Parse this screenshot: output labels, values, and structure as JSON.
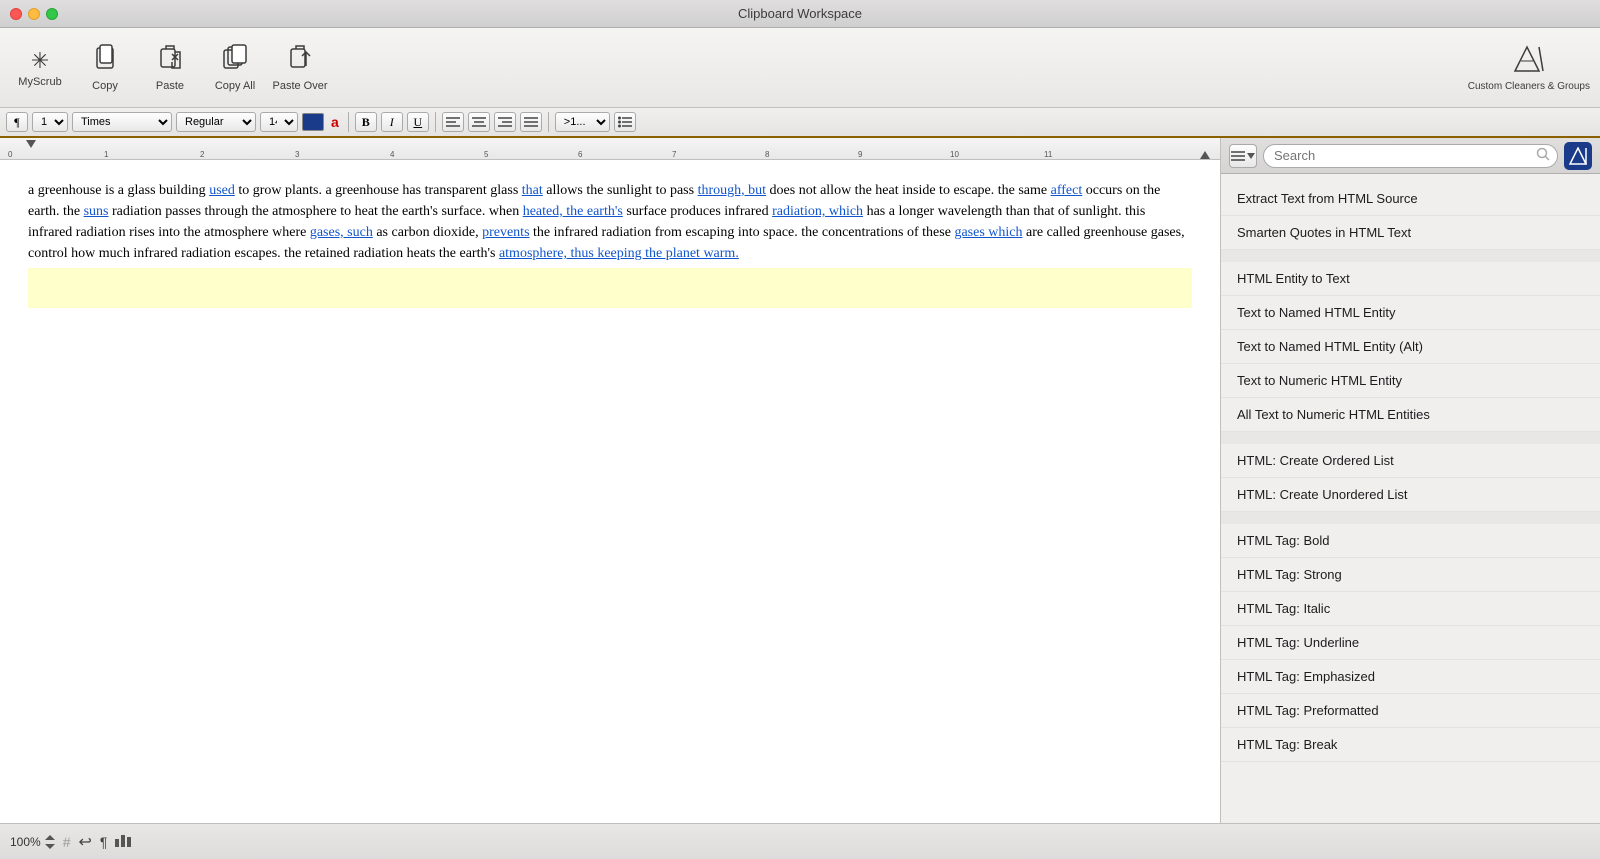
{
  "window": {
    "title": "Clipboard Workspace"
  },
  "toolbar": {
    "items": [
      {
        "id": "myscrub",
        "icon": "✳",
        "label": "MyScrub"
      },
      {
        "id": "copy",
        "icon": "⬜",
        "label": "Copy"
      },
      {
        "id": "paste",
        "icon": "🖊",
        "label": "Paste"
      },
      {
        "id": "copy-all",
        "icon": "📋",
        "label": "Copy All"
      },
      {
        "id": "paste-over",
        "icon": "✏",
        "label": "Paste Over"
      }
    ],
    "right": {
      "icon": "📊",
      "label": "Custom Cleaners & Groups"
    }
  },
  "format_bar": {
    "paragraph_marker": "¶",
    "font_family": "Times",
    "font_style": "Regular",
    "font_size": "14",
    "color": "#1a3a8a",
    "letter_a": "a",
    "bold": "B",
    "italic": "I",
    "underline": "U",
    "align_left": "≡",
    "align_center": "≡",
    "align_right": "≡",
    "align_justify": "≡",
    "list_options": ">1...",
    "list_icon": "☰"
  },
  "ruler": {
    "marks": [
      "0",
      "1",
      "2",
      "3",
      "4",
      "5",
      "6",
      "7",
      "8",
      "9",
      "10",
      "11"
    ]
  },
  "document": {
    "text_segments": [
      {
        "type": "text",
        "content": "a greenhouse is a glass building "
      },
      {
        "type": "link",
        "content": "used"
      },
      {
        "type": "text",
        "content": " to grow plants. a greenhouse has transparent glass "
      },
      {
        "type": "link",
        "content": "that"
      },
      {
        "type": "text",
        "content": " allows the sunlight to pass "
      },
      {
        "type": "link",
        "content": "through, but"
      },
      {
        "type": "text",
        "content": " does not allow the heat inside to escape. the same "
      },
      {
        "type": "link",
        "content": "affect"
      },
      {
        "type": "text",
        "content": " occurs on the earth. the "
      },
      {
        "type": "link",
        "content": "suns"
      },
      {
        "type": "text",
        "content": " radiation passes through the atmosphere to heat the earth's surface. when "
      },
      {
        "type": "link",
        "content": "heated, the earth's"
      },
      {
        "type": "text",
        "content": " surface produces infrared "
      },
      {
        "type": "link",
        "content": "radiation, which"
      },
      {
        "type": "text",
        "content": " has a longer wavelength than that of sunlight. this infrared radiation rises into the atmosphere where "
      },
      {
        "type": "link",
        "content": "gases, such"
      },
      {
        "type": "text",
        "content": " as carbon dioxide, "
      },
      {
        "type": "link",
        "content": "prevents"
      },
      {
        "type": "text",
        "content": " the infrared radiation from escaping into space. the concentrations of these "
      },
      {
        "type": "link",
        "content": "gases which"
      },
      {
        "type": "text",
        "content": " are called greenhouse gases, control how much infrared radiation escapes. the retained radiation heats the earth's "
      },
      {
        "type": "link",
        "content": "atmosphere, thus keeping the planet warm."
      }
    ]
  },
  "right_panel": {
    "search_placeholder": "Search",
    "items": [
      {
        "id": "extract-html",
        "label": "Extract Text from HTML Source",
        "group": 1
      },
      {
        "id": "smarten-quotes",
        "label": "Smarten Quotes in HTML Text",
        "group": 1
      },
      {
        "id": "html-entity-to-text",
        "label": "HTML Entity to Text",
        "group": 2
      },
      {
        "id": "text-to-named-html",
        "label": "Text to Named HTML Entity",
        "group": 2
      },
      {
        "id": "text-to-named-html-alt",
        "label": "Text to Named HTML Entity (Alt)",
        "group": 2
      },
      {
        "id": "text-to-numeric-html",
        "label": "Text to Numeric HTML Entity",
        "group": 2
      },
      {
        "id": "all-text-to-numeric",
        "label": "All Text to Numeric HTML Entities",
        "group": 2
      },
      {
        "id": "html-ordered-list",
        "label": "HTML: Create Ordered List",
        "group": 3
      },
      {
        "id": "html-unordered-list",
        "label": "HTML: Create Unordered List",
        "group": 3
      },
      {
        "id": "html-tag-bold",
        "label": "HTML Tag: Bold",
        "group": 4
      },
      {
        "id": "html-tag-strong",
        "label": "HTML Tag: Strong",
        "group": 4
      },
      {
        "id": "html-tag-italic",
        "label": "HTML Tag: Italic",
        "group": 4
      },
      {
        "id": "html-tag-underline",
        "label": "HTML Tag: Underline",
        "group": 4
      },
      {
        "id": "html-tag-emphasized",
        "label": "HTML Tag: Emphasized",
        "group": 4
      },
      {
        "id": "html-tag-preformatted",
        "label": "HTML Tag: Preformatted",
        "group": 4
      },
      {
        "id": "html-tag-break",
        "label": "HTML Tag: Break",
        "group": 4
      }
    ]
  },
  "status_bar": {
    "zoom": "100%",
    "hash": "#",
    "undo": "↩",
    "pilcrow": "¶",
    "chart": "📊"
  }
}
